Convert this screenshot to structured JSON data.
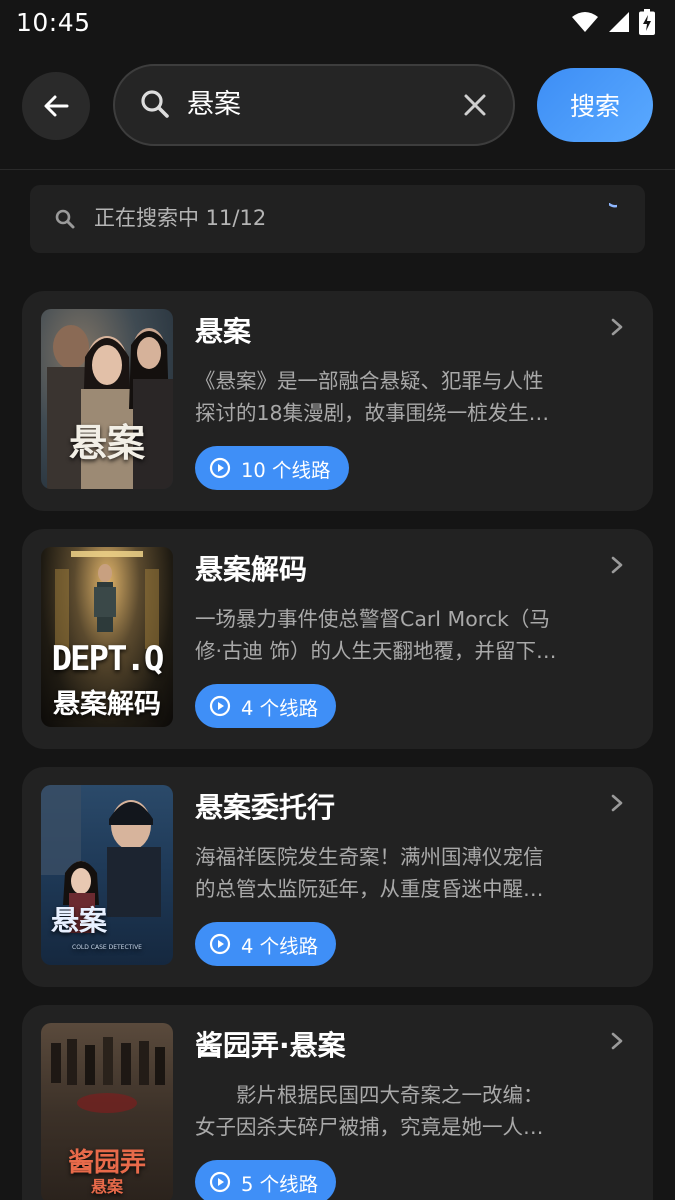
{
  "status_bar": {
    "time": "10:45"
  },
  "header": {
    "search_value": "悬案",
    "search_button": "搜索"
  },
  "progress": {
    "text": "正在搜索中 11/12"
  },
  "results": [
    {
      "title": "悬案",
      "desc_line1": "《悬案》是一部融合悬疑、犯罪与人性",
      "desc_line2": "探讨的18集漫剧，故事围绕一桩发生…",
      "routes": "10 个线路",
      "poster_text": "悬案"
    },
    {
      "title": "悬案解码",
      "desc_line1": "一场暴力事件使总警督Carl Morck（马",
      "desc_line2": "修·古迪 饰）的人生天翻地覆，并留下…",
      "routes": "4 个线路",
      "poster_text": "DEPT.Q",
      "poster_sub": "悬案解码"
    },
    {
      "title": "悬案委托行",
      "desc_line1": "海福祥医院发生奇案！满州国溥仪宠信",
      "desc_line2": "的总管太监阮延年，从重度昏迷中醒…",
      "routes": "4 个线路",
      "poster_text": "悬案",
      "poster_sub": "COLD CASE DETECTIVE"
    },
    {
      "title": "酱园弄·悬案",
      "desc_line1": "　　影片根据民国四大奇案之一改编：",
      "desc_line2": "女子因杀夫碎尸被捕，究竟是她一人…",
      "routes": "5 个线路",
      "poster_text": "酱园弄",
      "poster_sub": "悬案"
    }
  ],
  "colors": {
    "background": "#151515",
    "card": "#222222",
    "accent": "#3f8ff7",
    "muted_text": "#a9a9a9"
  },
  "icons": [
    "wifi-icon",
    "signal-icon",
    "battery-charging-icon",
    "back-arrow-icon",
    "search-icon",
    "clear-icon",
    "chevron-right-icon",
    "play-circle-icon"
  ]
}
